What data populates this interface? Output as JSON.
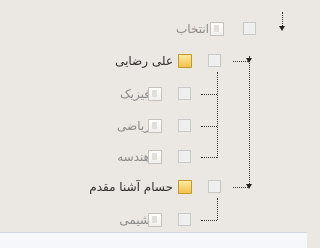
{
  "tree": {
    "root": {
      "label": "انتخاب"
    },
    "groups": [
      {
        "label": "علی رضایی",
        "children": [
          {
            "label": "فیزیک"
          },
          {
            "label": "ریاضی"
          },
          {
            "label": "هندسه"
          }
        ]
      },
      {
        "label": "حسام آشنا مقدم",
        "children": [
          {
            "label": "شیمی"
          }
        ]
      }
    ]
  },
  "colors": {
    "background": "#ebe7e2",
    "parent_text": "#2f2f2f",
    "child_text": "#8a8a8a",
    "folder": "#f3c24b"
  }
}
